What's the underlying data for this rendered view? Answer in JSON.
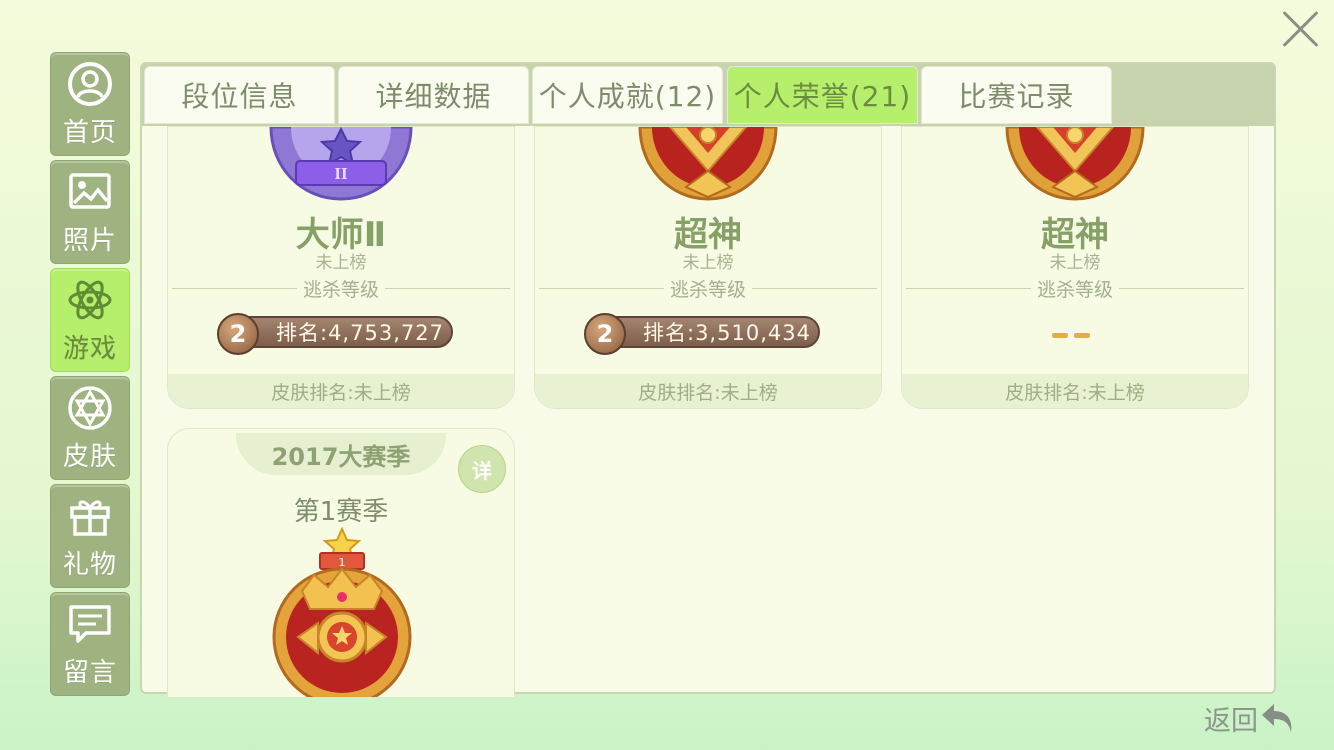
{
  "window": {
    "close_icon": "close-icon"
  },
  "sidebar": {
    "items": [
      {
        "label": "首页",
        "icon": "user-circle-icon",
        "active": false
      },
      {
        "label": "照片",
        "icon": "picture-icon",
        "active": false
      },
      {
        "label": "游戏",
        "icon": "atom-icon",
        "active": true
      },
      {
        "label": "皮肤",
        "icon": "hexagram-icon",
        "active": false
      },
      {
        "label": "礼物",
        "icon": "gift-icon",
        "active": false
      },
      {
        "label": "留言",
        "icon": "message-icon",
        "active": false
      }
    ]
  },
  "tabs": [
    {
      "label": "段位信息",
      "active": false
    },
    {
      "label": "详细数据",
      "active": false
    },
    {
      "label": "个人成就(12)",
      "active": false
    },
    {
      "label": "个人荣誉(21)",
      "active": true
    },
    {
      "label": "比赛记录",
      "active": false
    }
  ],
  "cards": [
    {
      "title": "大师Ⅱ",
      "status": "未上榜",
      "section": "逃杀等级",
      "rank_badge": "2",
      "rank_text": "排名:4,753,727",
      "skin_rank": "皮肤排名:未上榜",
      "medal": "master-medal-icon"
    },
    {
      "title": "超神",
      "status": "未上榜",
      "section": "逃杀等级",
      "rank_badge": "2",
      "rank_text": "排名:3,510,434",
      "skin_rank": "皮肤排名:未上榜",
      "medal": "god-medal-icon"
    },
    {
      "title": "超神",
      "status": "未上榜",
      "section": "逃杀等级",
      "rank_badge": "",
      "rank_text": "",
      "skin_rank": "皮肤排名:未上榜",
      "medal": "god-medal-icon"
    }
  ],
  "season_card": {
    "ribbon": "2017大赛季",
    "detail_label": "详",
    "season": "第1赛季",
    "medal_number": "1",
    "medal": "crown-medal-icon"
  },
  "footer": {
    "back_label": "返回",
    "back_icon": "back-arrow-icon"
  },
  "colors": {
    "accent": "#b6ef6c",
    "sidebar": "#9fb381",
    "tabbar": "#c7d3ac",
    "rank_pill": "#7d5e4c"
  }
}
